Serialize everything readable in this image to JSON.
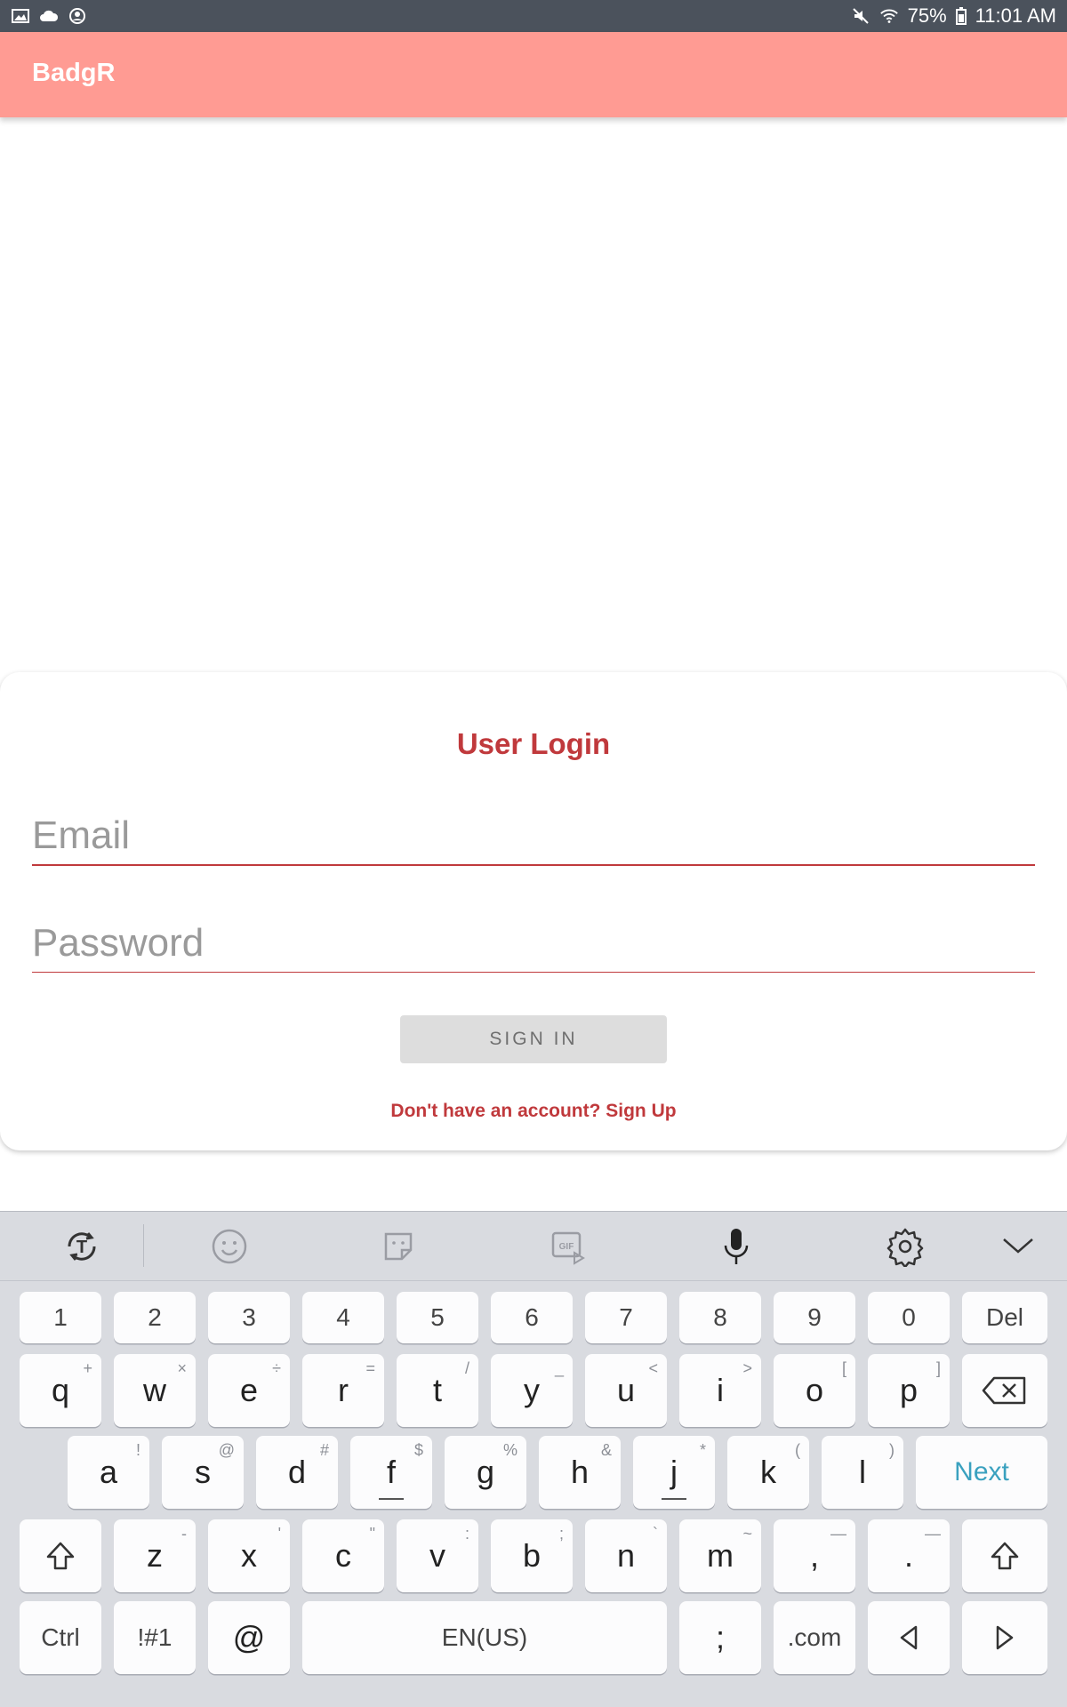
{
  "status_bar": {
    "battery": "75%",
    "time": "11:01 AM",
    "icons": [
      "gallery-icon",
      "cloud-icon",
      "account-icon",
      "mute-icon",
      "wifi-icon",
      "battery-icon"
    ]
  },
  "app_bar": {
    "title": "BadgR",
    "color": "#ff9b93"
  },
  "login": {
    "heading": "User Login",
    "email_placeholder": "Email",
    "password_placeholder": "Password",
    "sign_in": "SIGN IN",
    "sign_up": "Don't have an account? Sign Up",
    "accent": "#c0393c"
  },
  "keyboard": {
    "toolbar": [
      "text-mode-icon",
      "emoji-icon",
      "sticker-icon",
      "gif-icon",
      "microphone-icon",
      "settings-icon",
      "collapse-chevron-icon"
    ],
    "numbers": [
      "1",
      "2",
      "3",
      "4",
      "5",
      "6",
      "7",
      "8",
      "9",
      "0"
    ],
    "del": "Del",
    "row1": [
      {
        "k": "q",
        "h": "+"
      },
      {
        "k": "w",
        "h": "×"
      },
      {
        "k": "e",
        "h": "÷"
      },
      {
        "k": "r",
        "h": "="
      },
      {
        "k": "t",
        "h": "/"
      },
      {
        "k": "y",
        "h": "_"
      },
      {
        "k": "u",
        "h": "<"
      },
      {
        "k": "i",
        "h": ">"
      },
      {
        "k": "o",
        "h": "["
      },
      {
        "k": "p",
        "h": "]"
      }
    ],
    "row2": [
      {
        "k": "a",
        "h": "!"
      },
      {
        "k": "s",
        "h": "@"
      },
      {
        "k": "d",
        "h": "#"
      },
      {
        "k": "f",
        "h": "$"
      },
      {
        "k": "g",
        "h": "%"
      },
      {
        "k": "h",
        "h": "&"
      },
      {
        "k": "j",
        "h": "*"
      },
      {
        "k": "k",
        "h": "("
      },
      {
        "k": "l",
        "h": ")"
      }
    ],
    "next": "Next",
    "row3": [
      {
        "k": "z",
        "h": "-"
      },
      {
        "k": "x",
        "h": "'"
      },
      {
        "k": "c",
        "h": "\""
      },
      {
        "k": "v",
        "h": ":"
      },
      {
        "k": "b",
        "h": ";"
      },
      {
        "k": "n",
        "h": "`"
      },
      {
        "k": "m",
        "h": "~"
      },
      {
        "k": ",",
        "h": "—"
      },
      {
        "k": ".",
        "h": "—"
      }
    ],
    "ctrl": "Ctrl",
    "symbols": "!#1",
    "at": "@",
    "space": "EN(US)",
    "semicolon": ";",
    "dotcom": ".com"
  }
}
